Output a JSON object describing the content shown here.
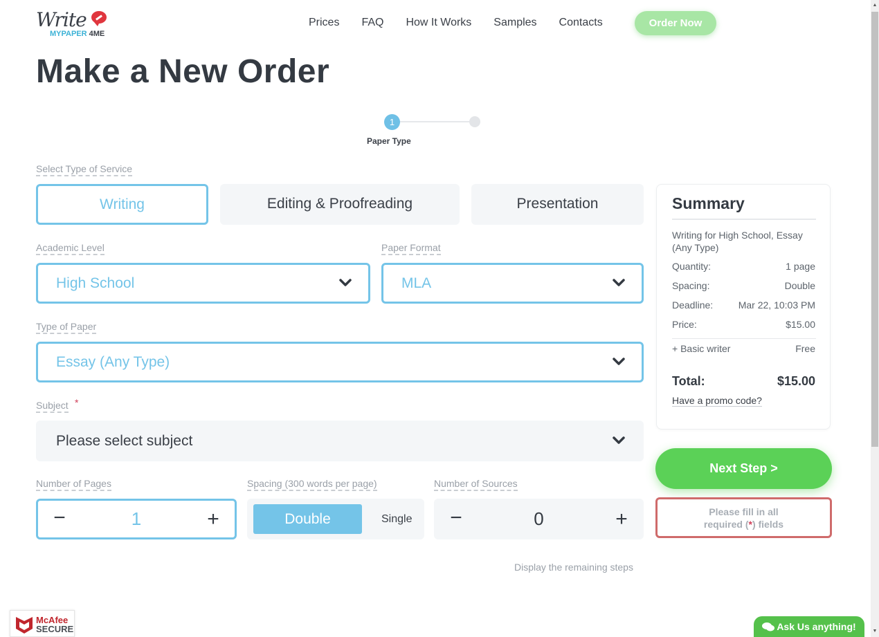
{
  "header": {
    "logo_script": "Write",
    "logo_sub_a": "MYPAPER",
    "logo_sub_b": "4ME",
    "nav": [
      "Prices",
      "FAQ",
      "How It Works",
      "Samples",
      "Contacts"
    ],
    "order_now": "Order Now"
  },
  "page_title": "Make a New Order",
  "stepper": {
    "current_step": "1",
    "current_label": "Paper Type",
    "total_steps": 2
  },
  "service": {
    "label": "Select Type of Service",
    "options": [
      "Writing",
      "Editing & Proofreading",
      "Presentation"
    ],
    "selected": "Writing"
  },
  "academic_level": {
    "label": "Academic Level",
    "value": "High School"
  },
  "paper_format": {
    "label": "Paper Format",
    "value": "MLA"
  },
  "type_of_paper": {
    "label": "Type of Paper",
    "value": "Essay (Any Type)"
  },
  "subject": {
    "label": "Subject",
    "required_mark": "*",
    "placeholder": "Please select subject"
  },
  "pages": {
    "label": "Number of Pages",
    "value": "1",
    "minus": "−",
    "plus": "+"
  },
  "spacing": {
    "label": "Spacing (300 words per page)",
    "options": [
      "Double",
      "Single"
    ],
    "selected": "Double"
  },
  "sources": {
    "label": "Number of Sources",
    "value": "0",
    "minus": "−",
    "plus": "+"
  },
  "remaining_steps_link": "Display the remaining steps",
  "summary": {
    "title": "Summary",
    "description": "Writing for High School, Essay (Any Type)",
    "rows": [
      {
        "label": "Quantity:",
        "value": "1 page"
      },
      {
        "label": "Spacing:",
        "value": "Double"
      },
      {
        "label": "Deadline:",
        "value": "Mar 22, 10:03 PM"
      },
      {
        "label": "Price:",
        "value": "$15.00"
      }
    ],
    "addon": {
      "label": "+ Basic writer",
      "value": "Free"
    },
    "total_label": "Total:",
    "total_value": "$15.00",
    "promo_link": "Have a promo code?"
  },
  "next_step": "Next Step >",
  "warning": {
    "line1": "Please fill in all",
    "line2_a": "required (",
    "line2_star": "*",
    "line2_b": ") fields"
  },
  "badge": {
    "line1": "McAfee",
    "line2": "SECURE"
  },
  "chat": {
    "icon": "chat-bubbles-icon",
    "label": "Ask Us anything!"
  },
  "colors": {
    "accent_blue": "#74c4e8",
    "green": "#5bd157",
    "warning_red": "#cf6b6b"
  }
}
